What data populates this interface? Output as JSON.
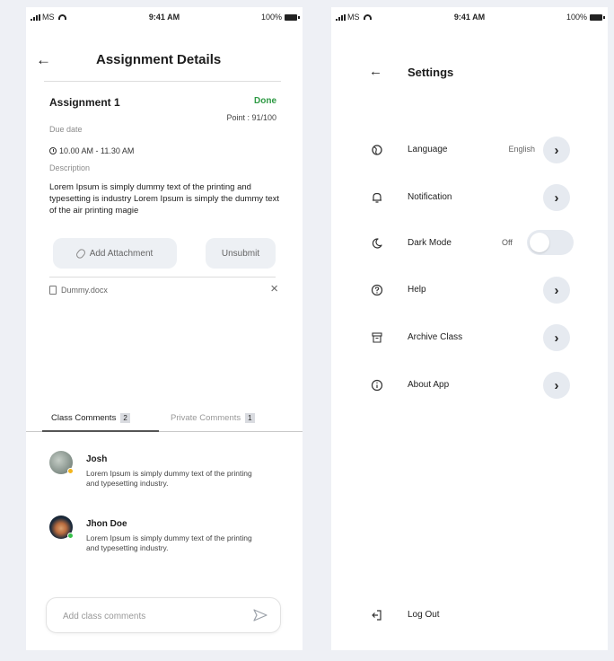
{
  "status_bar": {
    "carrier": "MS",
    "time": "9:41 AM",
    "battery": "100%"
  },
  "assignment_screen": {
    "title": "Assignment Details",
    "assignment_name": "Assignment 1",
    "status": "Done",
    "point": "Point : 91/100",
    "due_label": "Due date",
    "due_time": "10.00 AM - 11.30 AM",
    "description_label": "Description",
    "description": "Lorem Ipsum is simply dummy text of the printing and typesetting is industry Lorem Ipsum is simply the  dummy text of the air printing magie",
    "add_attachment": "Add Attachment",
    "unsubmit": "Unsubmit",
    "file_name": "Dummy.docx",
    "tabs": [
      {
        "label": "Class Comments",
        "count": "2"
      },
      {
        "label": "Private Comments",
        "count": "1"
      }
    ],
    "comments": [
      {
        "name": "Josh",
        "text": "Lorem Ipsum is simply dummy text of the printing and typesetting industry."
      },
      {
        "name": "Jhon Doe",
        "text": "Lorem Ipsum is simply dummy text of the printing and typesetting industry."
      }
    ],
    "comment_placeholder": "Add class comments"
  },
  "settings_screen": {
    "title": "Settings",
    "items": [
      {
        "label": "Language",
        "value": "English",
        "icon": "globe-icon"
      },
      {
        "label": "Notification",
        "icon": "bell-icon"
      },
      {
        "label": "Dark Mode",
        "value": "Off",
        "icon": "moon-icon"
      },
      {
        "label": "Help",
        "icon": "help-icon"
      },
      {
        "label": "Archive Class",
        "icon": "archive-icon"
      },
      {
        "label": "About App",
        "icon": "info-icon"
      }
    ],
    "logout": "Log Out"
  },
  "colors": {
    "done": "#2e9a44",
    "chip_bg": "#e6eaf0",
    "page_bg": "#eef0f5"
  }
}
